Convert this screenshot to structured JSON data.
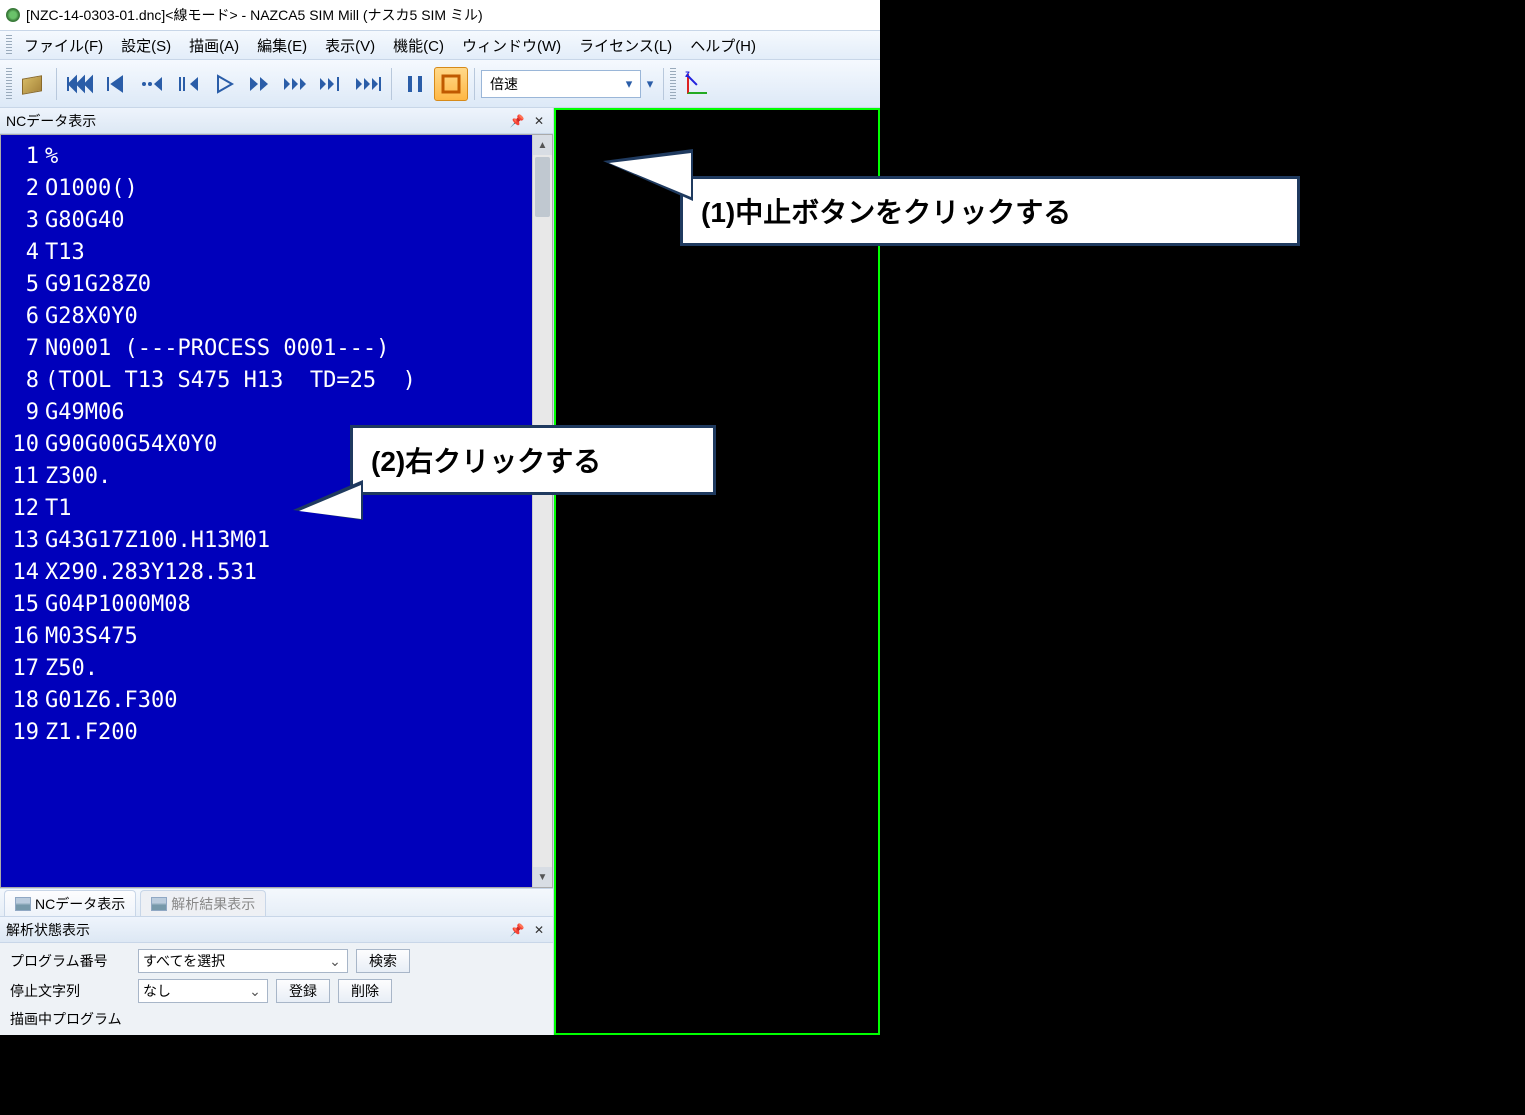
{
  "title": "[NZC-14-0303-01.dnc]<線モード>  - NAZCA5 SIM Mill (ナスカ5 SIM ミル)",
  "menu": {
    "file": "ファイル(F)",
    "settings": "設定(S)",
    "draw": "描画(A)",
    "edit": "編集(E)",
    "view": "表示(V)",
    "func": "機能(C)",
    "window": "ウィンドウ(W)",
    "license": "ライセンス(L)",
    "help": "ヘルプ(H)"
  },
  "toolbar": {
    "speed_label": "倍速"
  },
  "ncpanel": {
    "title": "NCデータ表示",
    "lines": [
      {
        "n": "1",
        "t": "%"
      },
      {
        "n": "2",
        "t": "O1000()"
      },
      {
        "n": "3",
        "t": "G80G40"
      },
      {
        "n": "4",
        "t": "T13"
      },
      {
        "n": "5",
        "t": "G91G28Z0"
      },
      {
        "n": "6",
        "t": "G28X0Y0"
      },
      {
        "n": "7",
        "t": "N0001 (---PROCESS 0001---)"
      },
      {
        "n": "8",
        "t": "(TOOL T13 S475 H13  TD=25  )"
      },
      {
        "n": "9",
        "t": "G49M06"
      },
      {
        "n": "10",
        "t": "G90G00G54X0Y0"
      },
      {
        "n": "11",
        "t": "Z300."
      },
      {
        "n": "12",
        "t": "T1"
      },
      {
        "n": "13",
        "t": "G43G17Z100.H13M01"
      },
      {
        "n": "14",
        "t": "X290.283Y128.531"
      },
      {
        "n": "15",
        "t": "G04P1000M08"
      },
      {
        "n": "16",
        "t": "M03S475"
      },
      {
        "n": "17",
        "t": "Z50."
      },
      {
        "n": "18",
        "t": "G01Z6.F300"
      },
      {
        "n": "19",
        "t": "Z1.F200"
      }
    ]
  },
  "tabs": {
    "ncview": "NCデータ表示",
    "analysisview": "解析結果表示"
  },
  "analysis": {
    "title": "解析状態表示",
    "program_no_label": "プログラム番号",
    "select_all": "すべてを選択",
    "search_btn": "検索",
    "stop_string_label": "停止文字列",
    "none": "なし",
    "register_btn": "登録",
    "delete_btn": "削除",
    "drawing_program_label": "描画中プログラム"
  },
  "callouts": {
    "c1": "(1)中止ボタンをクリックする",
    "c2": "(2)右クリックする"
  }
}
